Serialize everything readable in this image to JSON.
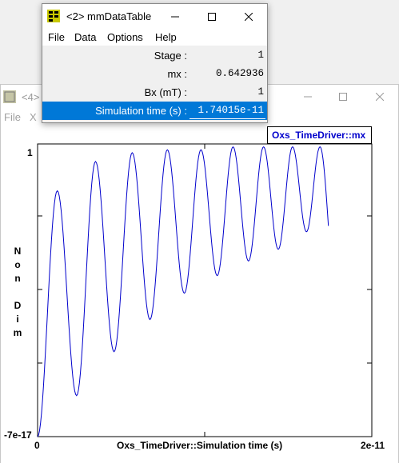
{
  "graph_window": {
    "title": "<4>",
    "menu": [
      "File",
      "X"
    ],
    "chart_data": {
      "type": "line",
      "title": "Oxs_TimeDriver::mx",
      "xlabel": "Oxs_TimeDriver::Simulation time (s)",
      "ylabel": "Non Dim",
      "x_min_label": "0",
      "x_max_label": "2e-11",
      "y_max_label": "1",
      "y_min_label": "-7e-17",
      "xlim": [
        0,
        2e-11
      ],
      "ylim": [
        0,
        1
      ],
      "line_color": "#0000cc",
      "series": [
        {
          "x": [
            0,
            1.74015e-11
          ],
          "values_description_peaks": [
            0.84,
            0.94,
            0.97,
            0.98,
            0.98,
            0.99,
            0.99,
            0.99,
            0.99
          ],
          "values_description_troughs": [
            0.0,
            0.14,
            0.29,
            0.4,
            0.49,
            0.55,
            0.6,
            0.64,
            0.7
          ]
        }
      ]
    }
  },
  "table_window": {
    "title": "<2> mmDataTable",
    "menu": [
      "File",
      "Data",
      "Options",
      "Help"
    ],
    "rows": [
      {
        "label": "Stage :",
        "value": "1"
      },
      {
        "label": "mx :",
        "value": "0.642936"
      },
      {
        "label": "Bx (mT) :",
        "value": "1"
      },
      {
        "label": "Simulation time (s) :",
        "value": "1.74015e-11"
      }
    ]
  },
  "colors": {
    "selection": "#0078d7",
    "plot_line": "#0000cc",
    "title_box_text": "#0000cc"
  }
}
